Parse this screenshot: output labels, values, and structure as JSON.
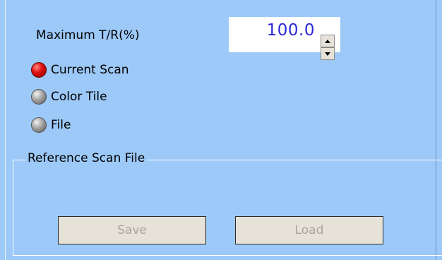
{
  "max_tr": {
    "label": "Maximum T/R(%)",
    "value": "100.0"
  },
  "source_options": [
    {
      "label": "Current Scan",
      "selected": true
    },
    {
      "label": "Color Tile",
      "selected": false
    },
    {
      "label": "File",
      "selected": false
    }
  ],
  "reference_group": {
    "title": "Reference Scan File",
    "save_label": "Save",
    "load_label": "Load"
  },
  "colors": {
    "background": "#9cc9f8",
    "value_text": "#2c28d8",
    "selected_radio": "#e01010",
    "disabled_text": "#a8a49a"
  }
}
